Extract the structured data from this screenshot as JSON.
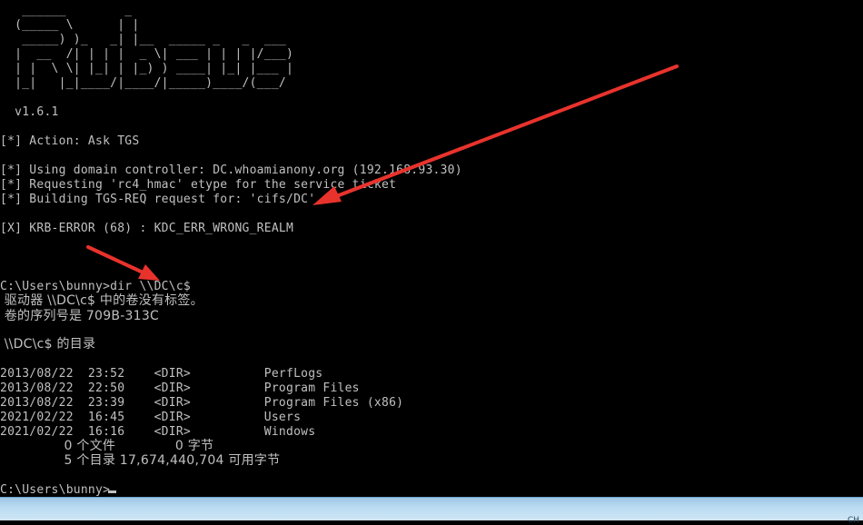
{
  "banner": [
    "   ______        _",
    "  (_____ \\      | |",
    "   _____) )_   _| |__  _____ _   _  ___",
    "  |  __  /| | | |  _ \\| ___ | | | |/___)",
    "  | |  \\ \\| |_| | |_) ) ____| |_| |___ |",
    "  |_|   |_|____/|____/|_____)____/(___/"
  ],
  "version": "  v1.6.1",
  "action": "[*] Action: Ask TGS",
  "messages": [
    "[*] Using domain controller: DC.whoamianony.org (192.168.93.30)",
    "[*] Requesting 'rc4_hmac' etype for the service ticket",
    "[*] Building TGS-REQ request for: 'cifs/DC'"
  ],
  "error": "[X] KRB-ERROR (68) : KDC_ERR_WRONG_REALM",
  "command": "C:\\Users\\bunny>dir \\\\DC\\c$",
  "volume": [
    " 驱动器 \\\\DC\\c$ 中的卷没有标签。",
    " 卷的序列号是 709B-313C"
  ],
  "dir_header": " \\\\DC\\c$ 的目录",
  "entries": [
    "2013/08/22  23:52    <DIR>          PerfLogs",
    "2013/08/22  22:50    <DIR>          Program Files",
    "2013/08/22  23:39    <DIR>          Program Files (x86)",
    "2021/02/22  16:45    <DIR>          Users",
    "2021/02/22  16:16    <DIR>          Windows"
  ],
  "summary": [
    "               0 个文件              0 字节",
    "               5 个目录 17,674,440,704 可用字节"
  ],
  "prompt": "C:\\Users\\bunny>",
  "tray": "CH",
  "colors": {
    "background": "#000000",
    "text": "#c0c0c0",
    "arrow": "#e8332c",
    "taskbar": "#b9dbf2"
  }
}
